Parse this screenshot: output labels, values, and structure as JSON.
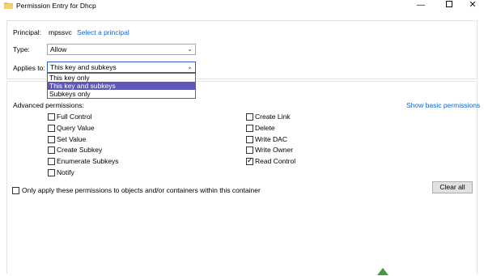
{
  "window": {
    "title": "Permission Entry for Dhcp",
    "min_glyph": "—",
    "close_glyph": "✕"
  },
  "principal": {
    "label": "Principal:",
    "value": "mpssvc",
    "link": "Select a principal"
  },
  "type": {
    "label": "Type:",
    "value": "Allow"
  },
  "applies_to": {
    "label": "Applies to:",
    "value": "This key and subkeys",
    "options": [
      "This key only",
      "This key and subkeys",
      "Subkeys only"
    ],
    "selected_index": 1
  },
  "permissions": {
    "heading": "Advanced permissions:",
    "toggle_link": "Show basic permissions",
    "left": [
      {
        "label": "Full Control",
        "checked": false
      },
      {
        "label": "Query Value",
        "checked": false
      },
      {
        "label": "Set Value",
        "checked": false
      },
      {
        "label": "Create Subkey",
        "checked": false
      },
      {
        "label": "Enumerate Subkeys",
        "checked": false
      },
      {
        "label": "Notify",
        "checked": false
      }
    ],
    "right": [
      {
        "label": "Create Link",
        "checked": false
      },
      {
        "label": "Delete",
        "checked": false
      },
      {
        "label": "Write DAC",
        "checked": false
      },
      {
        "label": "Write Owner",
        "checked": false
      },
      {
        "label": "Read Control",
        "checked": true
      }
    ],
    "check_glyph": "✓"
  },
  "apply_only": {
    "label": "Only apply these permissions to objects and/or containers within this container",
    "checked": false
  },
  "clear_all_label": "Clear all"
}
